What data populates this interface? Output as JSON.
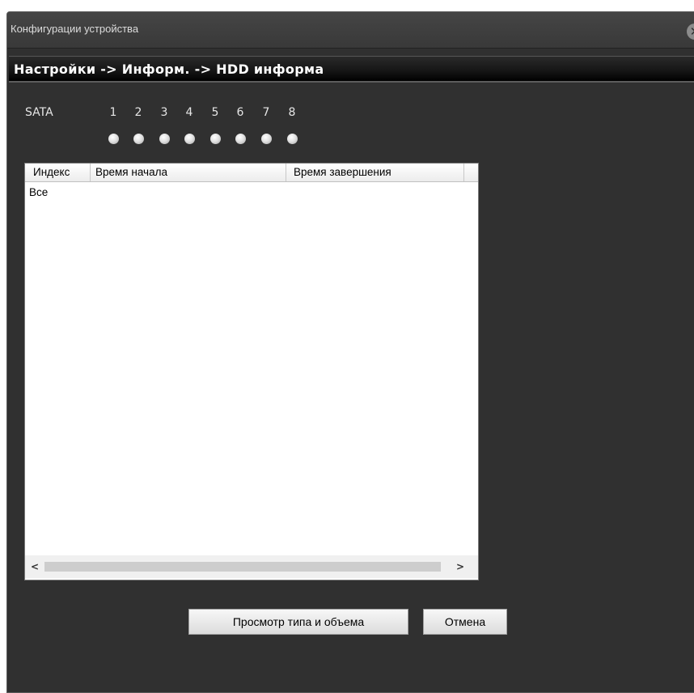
{
  "window": {
    "title": "Конфигурации устройства",
    "close_icon": "close-icon"
  },
  "breadcrumb": "Настройки -> Информ. -> HDD информа",
  "sata": {
    "label": "SATA",
    "disks": [
      {
        "num": "1"
      },
      {
        "num": "2"
      },
      {
        "num": "3"
      },
      {
        "num": "4"
      },
      {
        "num": "5"
      },
      {
        "num": "6"
      },
      {
        "num": "7"
      },
      {
        "num": "8"
      }
    ]
  },
  "table": {
    "columns": [
      "Индекс",
      "Время начала",
      "Время завершения"
    ],
    "rows": [
      {
        "index": "Все",
        "start": "",
        "end": ""
      }
    ],
    "scroll_left": "<",
    "scroll_right": ">"
  },
  "buttons": {
    "view": "Просмотр типа и объема",
    "cancel": "Отмена"
  },
  "colors": {
    "window_bg": "#303030",
    "titlebar_bg": "#3f3f3f",
    "breadcrumb_bg": "#151515",
    "table_bg": "#ffffff"
  }
}
